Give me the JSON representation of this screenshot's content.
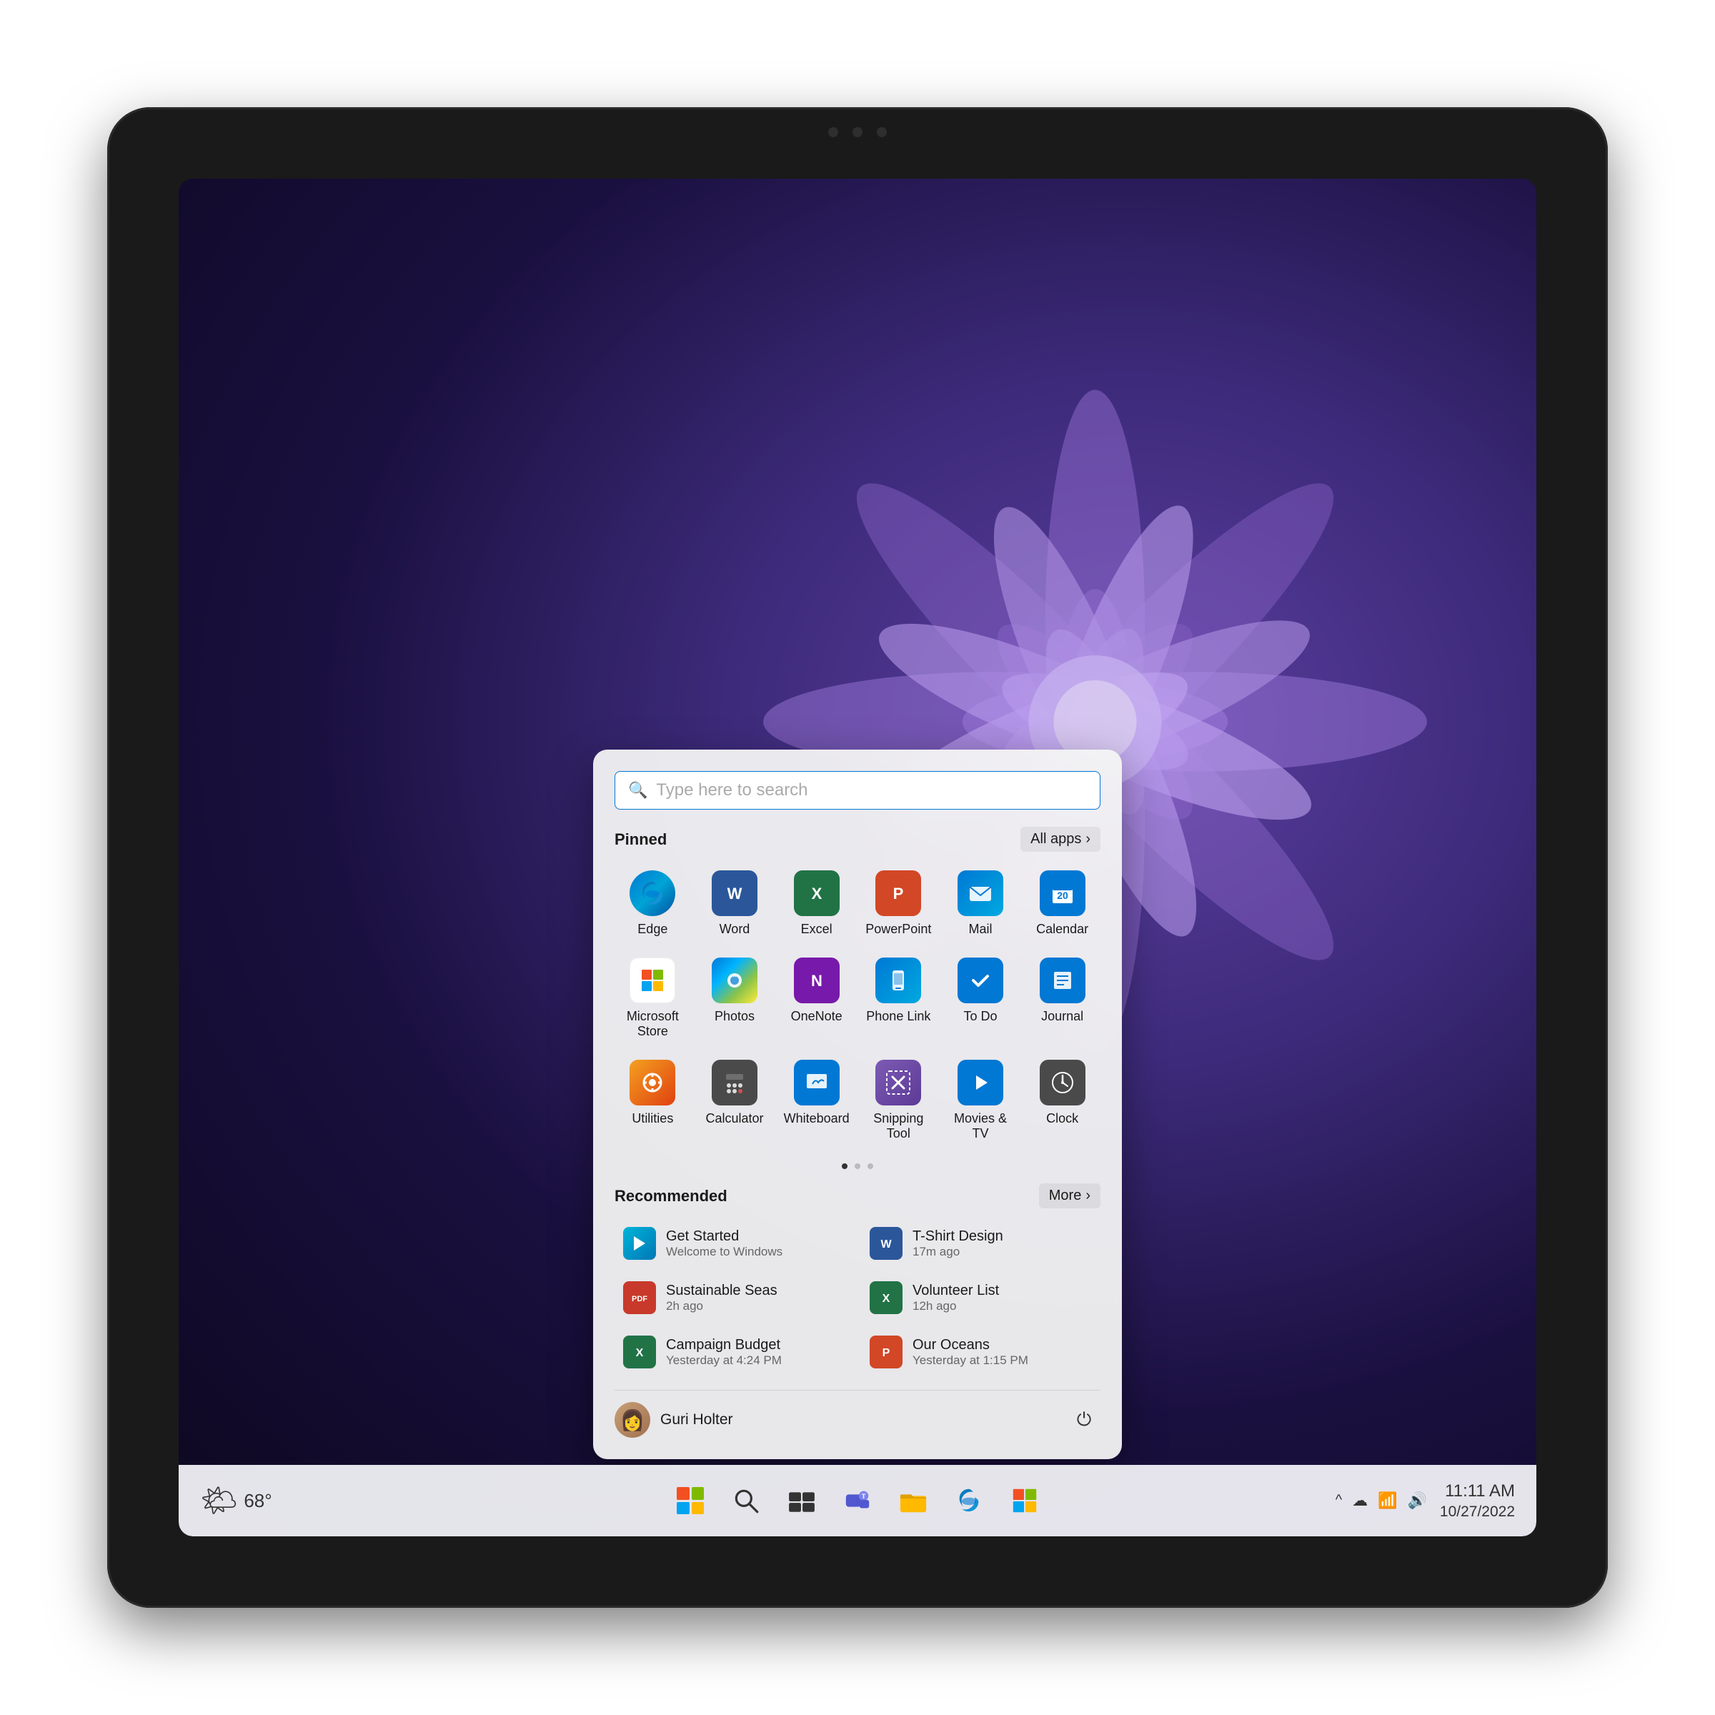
{
  "device": {
    "camera": "camera"
  },
  "wallpaper": {
    "description": "Windows 11 bloom wallpaper purple"
  },
  "start_menu": {
    "search": {
      "placeholder": "Type here to search"
    },
    "pinned": {
      "title": "Pinned",
      "all_apps_label": "All apps",
      "apps": [
        {
          "name": "Edge",
          "color": "edge"
        },
        {
          "name": "Word",
          "color": "word"
        },
        {
          "name": "Excel",
          "color": "excel"
        },
        {
          "name": "PowerPoint",
          "color": "powerpoint"
        },
        {
          "name": "Mail",
          "color": "mail"
        },
        {
          "name": "Calendar",
          "color": "calendar"
        },
        {
          "name": "Microsoft Store",
          "color": "msstore"
        },
        {
          "name": "Photos",
          "color": "photos"
        },
        {
          "name": "OneNote",
          "color": "onenote"
        },
        {
          "name": "Phone Link",
          "color": "phonelink"
        },
        {
          "name": "To Do",
          "color": "todo"
        },
        {
          "name": "Journal",
          "color": "journal"
        },
        {
          "name": "Utilities",
          "color": "utilities"
        },
        {
          "name": "Calculator",
          "color": "calculator"
        },
        {
          "name": "Whiteboard",
          "color": "whiteboard"
        },
        {
          "name": "Snipping Tool",
          "color": "snipping"
        },
        {
          "name": "Movies & TV",
          "color": "moviestv"
        },
        {
          "name": "Clock",
          "color": "clock"
        }
      ]
    },
    "recommended": {
      "title": "Recommended",
      "more_label": "More",
      "items": [
        {
          "name": "Get Started",
          "subtitle": "Welcome to Windows",
          "color": "get-started"
        },
        {
          "name": "T-Shirt Design",
          "subtitle": "17m ago",
          "color": "word-sm"
        },
        {
          "name": "Sustainable Seas",
          "subtitle": "2h ago",
          "color": "pdf"
        },
        {
          "name": "Volunteer List",
          "subtitle": "12h ago",
          "color": "excel-sm"
        },
        {
          "name": "Campaign Budget",
          "subtitle": "Yesterday at 4:24 PM",
          "color": "excel2"
        },
        {
          "name": "Our Oceans",
          "subtitle": "Yesterday at 1:15 PM",
          "color": "ppt"
        }
      ]
    },
    "user": {
      "name": "Guri Holter",
      "avatar": "👩"
    }
  },
  "taskbar": {
    "weather": {
      "temp": "68°",
      "icon": "🌤"
    },
    "icons": [
      {
        "name": "start-button",
        "label": "Start"
      },
      {
        "name": "search-button",
        "label": "Search"
      },
      {
        "name": "task-view-button",
        "label": "Task View"
      },
      {
        "name": "teams-button",
        "label": "Teams"
      },
      {
        "name": "file-explorer-button",
        "label": "File Explorer"
      },
      {
        "name": "edge-button",
        "label": "Edge"
      },
      {
        "name": "store-button",
        "label": "Microsoft Store"
      }
    ],
    "system": {
      "chevron": "^",
      "onedrive": "☁",
      "wifi": "📶",
      "volume": "🔊"
    },
    "clock": {
      "time": "11:11 AM",
      "date": "10/27/2022"
    }
  }
}
